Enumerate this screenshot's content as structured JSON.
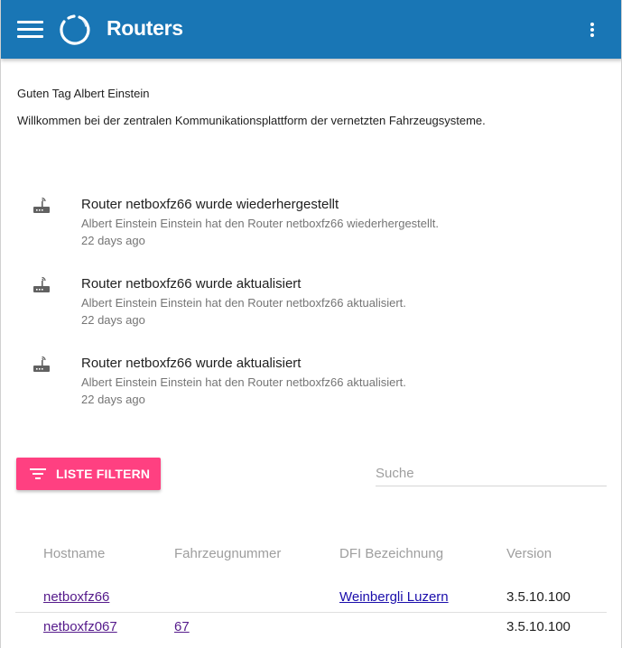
{
  "appbar": {
    "title": "Routers",
    "menu_icon": "hamburger-menu-icon",
    "logo_icon": "brand-ring-logo",
    "more_icon": "more-vertical-icon",
    "color": "#1976b5"
  },
  "intro": {
    "greeting": "Guten Tag Albert Einstein",
    "welcome": "Willkommen bei der zentralen Kommunikationsplattform der vernetzten Fahrzeugsysteme."
  },
  "activities": [
    {
      "icon": "router-icon",
      "title": "Router netboxfz66 wurde wiederhergestellt",
      "description": "Albert Einstein Einstein hat den Router netboxfz66 wiederhergestellt.",
      "time": "22 days ago"
    },
    {
      "icon": "router-icon",
      "title": "Router netboxfz66 wurde aktualisiert",
      "description": "Albert Einstein Einstein hat den Router netboxfz66 aktualisiert.",
      "time": "22 days ago"
    },
    {
      "icon": "router-icon",
      "title": "Router netboxfz66 wurde aktualisiert",
      "description": "Albert Einstein Einstein hat den Router netboxfz66 aktualisiert.",
      "time": "22 days ago"
    }
  ],
  "toolbar": {
    "filter_label": "LISTE FILTERN",
    "filter_icon": "filter-list-icon",
    "filter_color": "#ff4081",
    "search_placeholder": "Suche"
  },
  "table": {
    "columns": [
      "Hostname",
      "Fahrzeugnummer",
      "DFI Bezeichnung",
      "Version"
    ],
    "rows": [
      {
        "hostname": "netboxfz66",
        "fahrzeugnummer": "",
        "dfi": "Weinbergli Luzern",
        "version": "3.5.10.100"
      },
      {
        "hostname": "netboxfz067",
        "fahrzeugnummer": "67",
        "dfi": "",
        "version": "3.5.10.100"
      }
    ]
  }
}
